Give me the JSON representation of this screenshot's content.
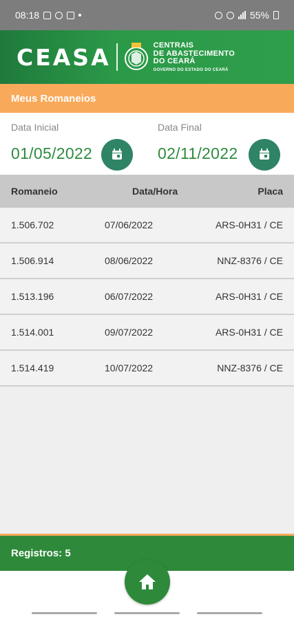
{
  "statusbar": {
    "time": "08:18",
    "battery": "55%"
  },
  "brand": {
    "logo": "CEASA",
    "sub_line1": "CENTRAIS",
    "sub_line2": "DE ABASTECIMENTO",
    "sub_line3": "DO CEARÁ",
    "sub_line4": "GOVERNO DO ESTADO DO CEARÁ"
  },
  "section": {
    "title": "Meus Romaneios"
  },
  "dates": {
    "start_label": "Data Inicial",
    "start_value": "01/05/2022",
    "end_label": "Data Final",
    "end_value": "02/11/2022"
  },
  "table": {
    "headers": [
      "Romaneio",
      "Data/Hora",
      "Placa"
    ],
    "rows": [
      [
        "1.506.702",
        "07/06/2022",
        "ARS-0H31 / CE"
      ],
      [
        "1.506.914",
        "08/06/2022",
        "NNZ-8376 / CE"
      ],
      [
        "1.513.196",
        "06/07/2022",
        "ARS-0H31 / CE"
      ],
      [
        "1.514.001",
        "09/07/2022",
        "ARS-0H31 / CE"
      ],
      [
        "1.514.419",
        "10/07/2022",
        "NNZ-8376 / CE"
      ]
    ]
  },
  "footer": {
    "records": "Registros: 5"
  },
  "colors": {
    "primary_green": "#2e8a3a",
    "accent_orange": "#f9a95a",
    "date_green": "#2e8b3e",
    "button_teal": "#2e8465"
  },
  "icons": [
    "image-icon",
    "cloud-icon",
    "instagram-icon",
    "alarm-icon",
    "wifi-icon",
    "signal-icon",
    "battery-icon",
    "calendar-icon",
    "home-icon"
  ]
}
